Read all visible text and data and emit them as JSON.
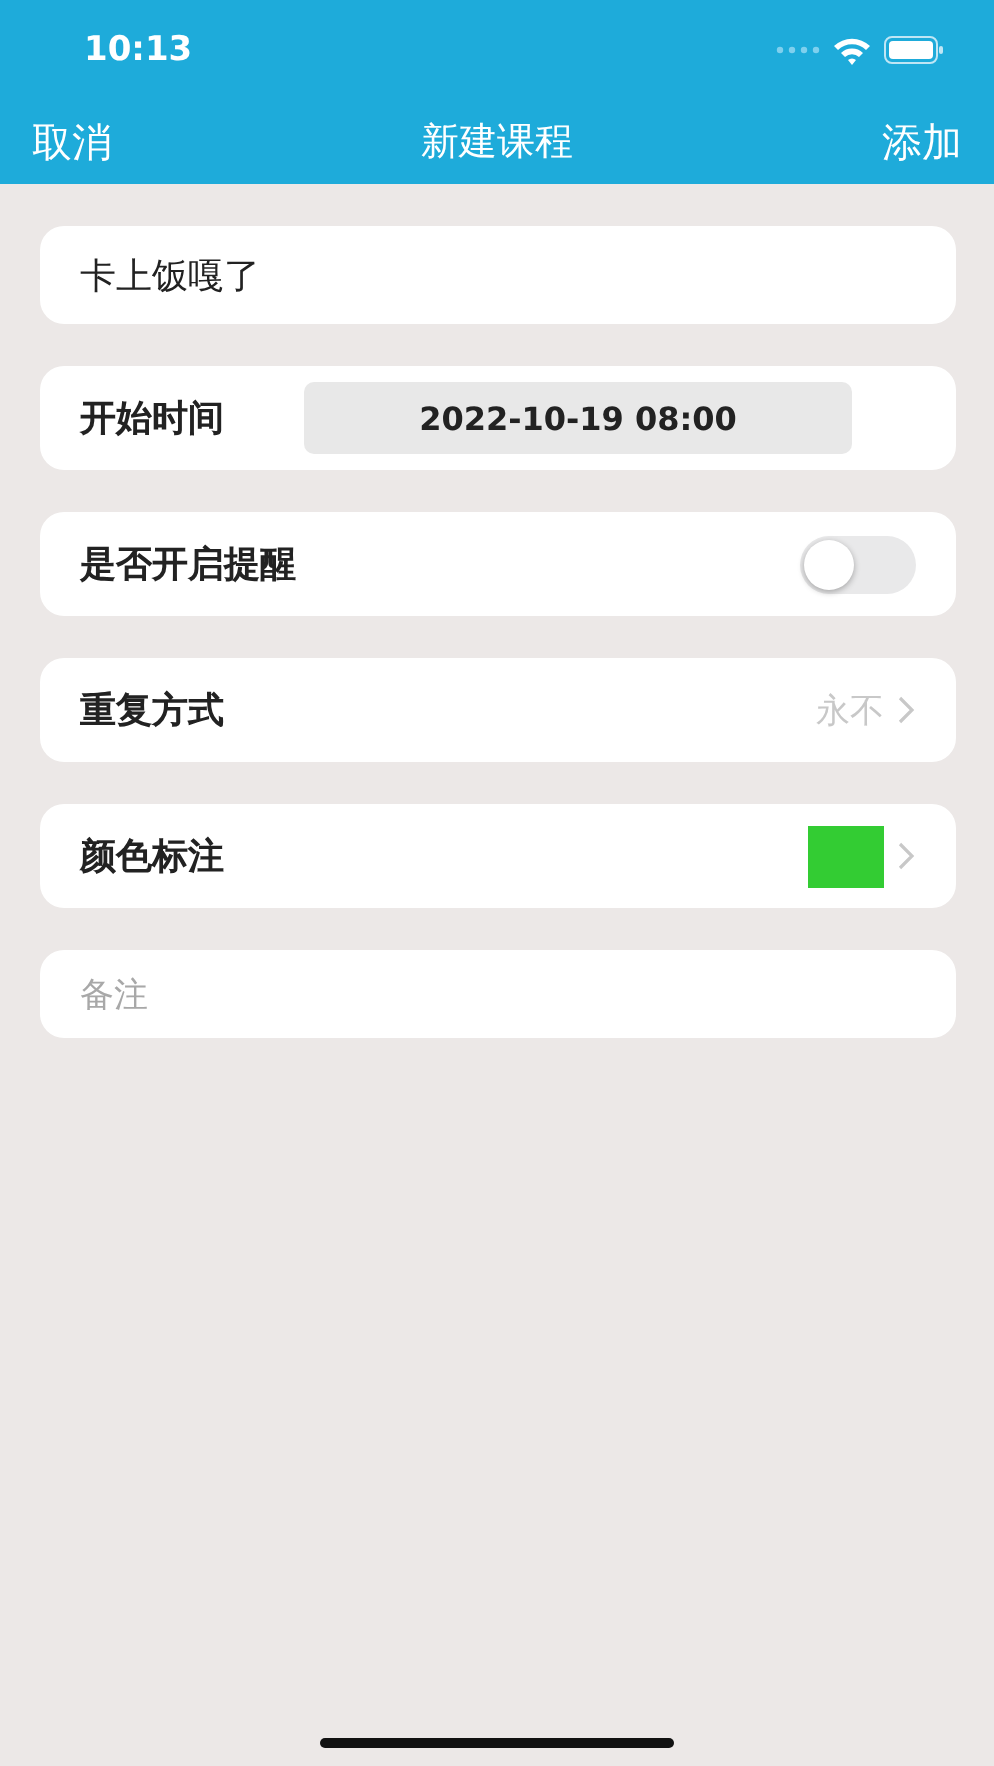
{
  "status_bar": {
    "time": "10:13"
  },
  "nav": {
    "left": "取消",
    "title": "新建课程",
    "right": "添加"
  },
  "rows": [
    {
      "kind": "text_input",
      "value": "卡上饭嘎了"
    },
    {
      "kind": "date",
      "label": "开始时间",
      "value": "2022-10-19 08:00"
    },
    {
      "kind": "toggle",
      "label": "是否开启提醒",
      "on": false
    },
    {
      "kind": "select",
      "label": "重复方式",
      "value": "永不"
    },
    {
      "kind": "color",
      "label": "颜色标注",
      "color": "#33cc33"
    },
    {
      "kind": "note",
      "placeholder": "备注"
    }
  ]
}
